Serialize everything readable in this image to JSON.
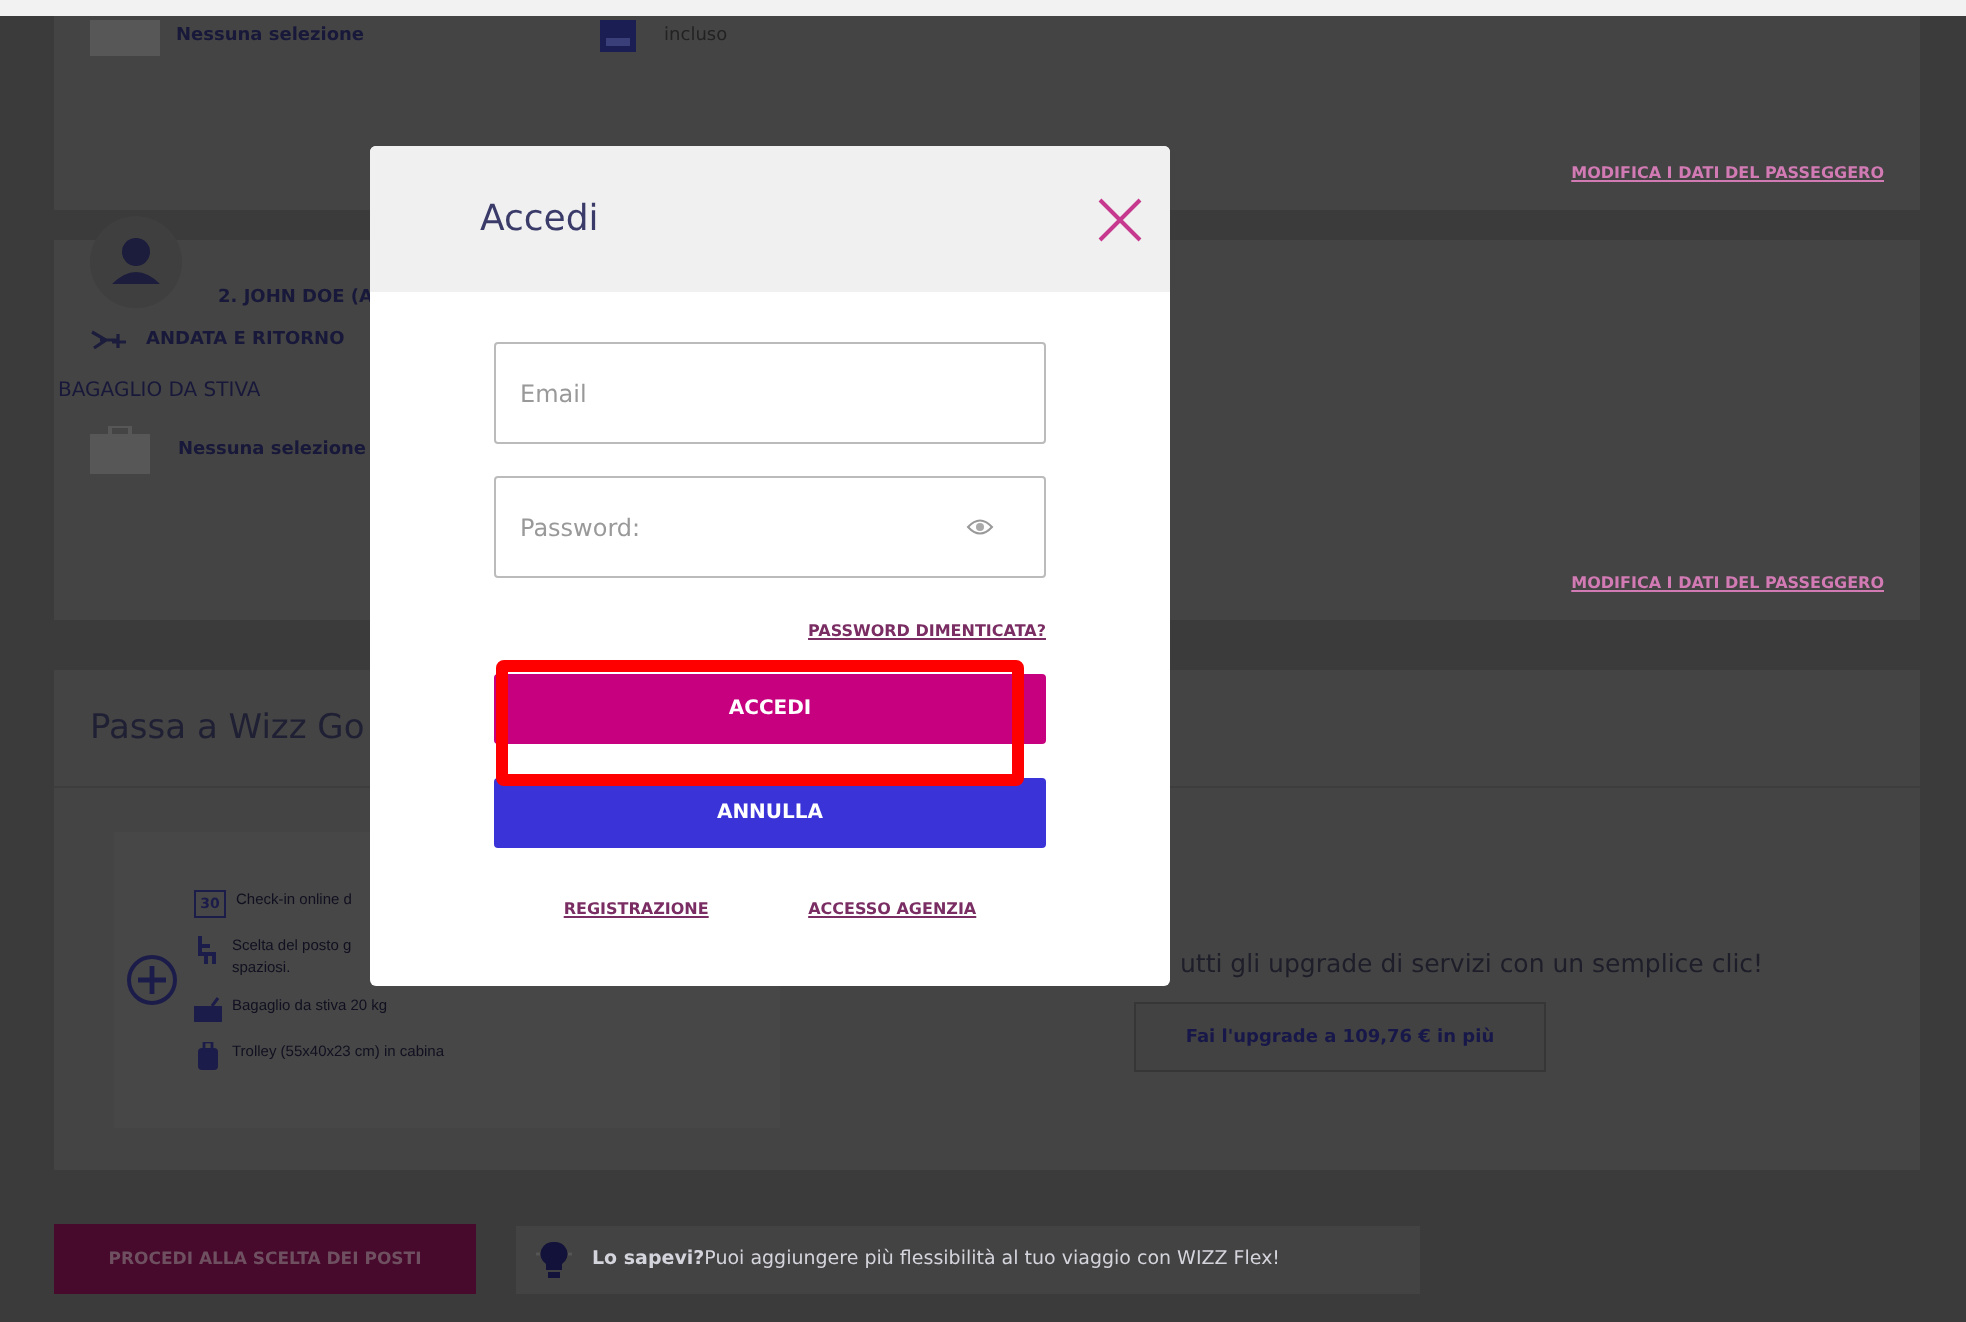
{
  "passenger_1": {
    "baggage_status": "Nessuna selezione",
    "cabin_status": "incluso",
    "edit_link": "MODIFICA I DATI DEL PASSEGGERO"
  },
  "passenger_2": {
    "name": "2. JOHN DOE (A",
    "trip": "ANDATA E RITORNO",
    "section": "BAGAGLIO DA STIVA",
    "baggage_status": "Nessuna selezione",
    "edit_link": "MODIFICA I DATI DEL PASSEGGERO"
  },
  "upgrade": {
    "title": "Passa a Wizz Go",
    "benefits": [
      {
        "kind": "calendar",
        "icon_text": "30",
        "lines": [
          "Check-in online d"
        ]
      },
      {
        "kind": "seat",
        "lines": [
          "Scelta del posto g",
          "spaziosi."
        ]
      },
      {
        "kind": "bag",
        "lines": [
          "Bagaglio da stiva 20 kg"
        ]
      },
      {
        "kind": "trolley",
        "lines": [
          "Trolley (55x40x23 cm) in cabina"
        ]
      }
    ],
    "tagline": "utti gli upgrade di servizi con un semplice clic!",
    "button": "Fai l'upgrade a 109,76 € in più"
  },
  "footer": {
    "button": "PROCEDI ALLA SCELTA DEI POSTI",
    "tip": "**Lo sapevi?**Puoi aggiungere più flessibilità al tuo viaggio con WIZZ Flex!"
  },
  "modal": {
    "title": "Accedi",
    "email": {
      "placeholder": "Email"
    },
    "password": {
      "placeholder": "Password:"
    },
    "forgot_link": "PASSWORD DIMENTICATA?",
    "buttons": [
      {
        "label": "ACCEDI",
        "kind": "primary"
      },
      {
        "label": "ANNULLA",
        "kind": "secondary"
      }
    ],
    "links": [
      "REGISTRAZIONE",
      "ACCESSO AGENZIA"
    ]
  }
}
